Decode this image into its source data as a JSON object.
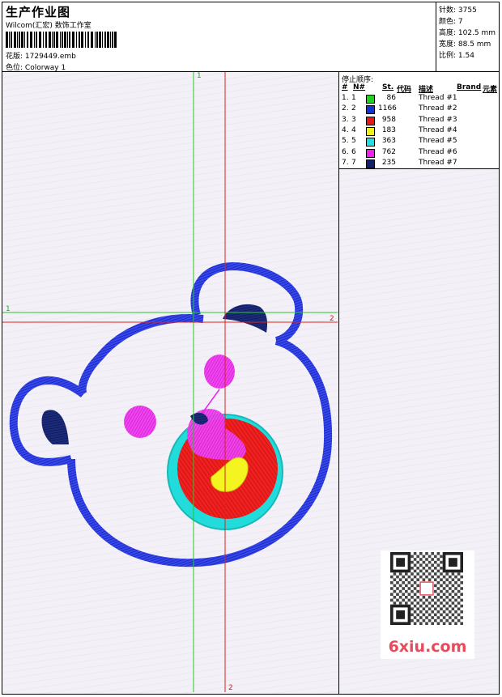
{
  "header": {
    "title": "生产作业图",
    "company": "Wilcom(汇宏) 数饰工作室",
    "design_label": "花版: ",
    "design_value": "1729449.emb",
    "colorway_label": "色位: ",
    "colorway_value": "Colorway 1"
  },
  "stats": {
    "stitches": "针数: 3755",
    "colors": "颜色: 7",
    "height": "高度: 102.5 mm",
    "width": "宽度: 88.5 mm",
    "scale": "比例: 1.54"
  },
  "legend": {
    "title": "停止顺序:",
    "headers": {
      "num": "#",
      "needle": "N#",
      "stitches": "St.",
      "code": "代码",
      "desc": "描述",
      "brand": "Brand",
      "element": "元素"
    },
    "rows": [
      {
        "num": "1.",
        "needle": "1",
        "stitches": "86",
        "desc": "Thread #1",
        "color": "#1fd21f"
      },
      {
        "num": "2.",
        "needle": "2",
        "stitches": "1166",
        "desc": "Thread #2",
        "color": "#1030d8"
      },
      {
        "num": "3.",
        "needle": "3",
        "stitches": "958",
        "desc": "Thread #3",
        "color": "#e81818"
      },
      {
        "num": "4.",
        "needle": "4",
        "stitches": "183",
        "desc": "Thread #4",
        "color": "#f2f21a"
      },
      {
        "num": "5.",
        "needle": "5",
        "stitches": "363",
        "desc": "Thread #5",
        "color": "#22e0e0"
      },
      {
        "num": "6.",
        "needle": "6",
        "stitches": "762",
        "desc": "Thread #6",
        "color": "#ee22ee"
      },
      {
        "num": "7.",
        "needle": "7",
        "stitches": "235",
        "desc": "Thread #7",
        "color": "#142068"
      }
    ]
  },
  "axes": {
    "v_green": "1",
    "h_green": "1",
    "h_red": "2",
    "v_red": "2"
  },
  "watermark": "6xiu.com",
  "colors": {
    "green_line": "#22cc22",
    "red_line": "#dd2222"
  }
}
